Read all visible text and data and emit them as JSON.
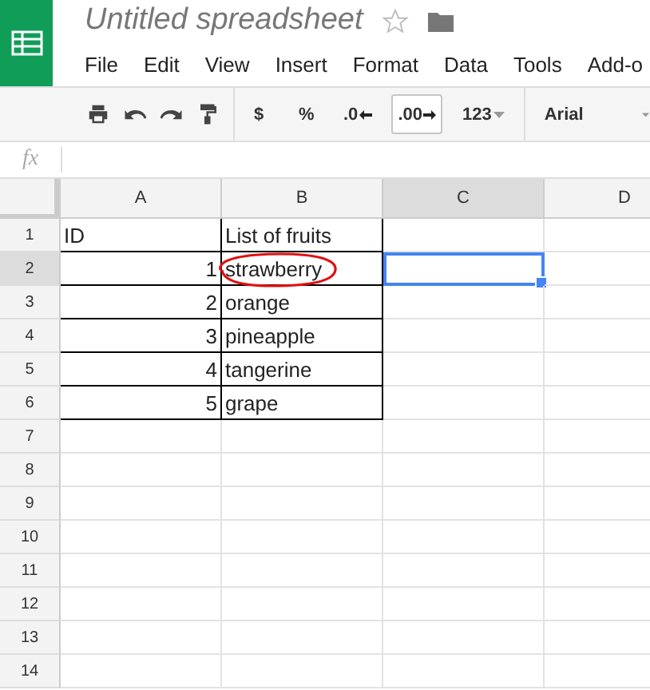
{
  "title": "Untitled spreadsheet",
  "menu": [
    "File",
    "Edit",
    "View",
    "Insert",
    "Format",
    "Data",
    "Tools",
    "Add-o"
  ],
  "toolbar": {
    "currency": "$",
    "percent": "%",
    "decrease_decimals": ".0",
    "increase_decimals": ".00",
    "increase_decimals_pressed": true,
    "number_format": "123",
    "font": "Arial"
  },
  "formula_bar": {
    "label": "fx"
  },
  "columns": [
    {
      "label": "A",
      "selected": false
    },
    {
      "label": "B",
      "selected": false
    },
    {
      "label": "C",
      "selected": true
    },
    {
      "label": "D",
      "selected": false
    }
  ],
  "rows": [
    {
      "number": "1",
      "selected": false,
      "cells": [
        {
          "kind": "text",
          "value": "ID"
        },
        {
          "kind": "text",
          "value": "List of fruits",
          "circled": false
        }
      ]
    },
    {
      "number": "2",
      "selected": true,
      "cells": [
        {
          "kind": "number",
          "value": "1"
        },
        {
          "kind": "text",
          "value": "strawberry",
          "circled": true
        }
      ]
    },
    {
      "number": "3",
      "selected": false,
      "cells": [
        {
          "kind": "number",
          "value": "2"
        },
        {
          "kind": "text",
          "value": "orange",
          "circled": false
        }
      ]
    },
    {
      "number": "4",
      "selected": false,
      "cells": [
        {
          "kind": "number",
          "value": "3"
        },
        {
          "kind": "text",
          "value": "pineapple",
          "circled": false
        }
      ]
    },
    {
      "number": "5",
      "selected": false,
      "cells": [
        {
          "kind": "number",
          "value": "4"
        },
        {
          "kind": "text",
          "value": "tangerine",
          "circled": false
        }
      ]
    },
    {
      "number": "6",
      "selected": false,
      "cells": [
        {
          "kind": "number",
          "value": "5"
        },
        {
          "kind": "text",
          "value": "grape",
          "circled": false
        }
      ]
    },
    {
      "number": "7",
      "selected": false
    },
    {
      "number": "8",
      "selected": false
    },
    {
      "number": "9",
      "selected": false
    },
    {
      "number": "10",
      "selected": false
    },
    {
      "number": "11",
      "selected": false
    },
    {
      "number": "12",
      "selected": false
    },
    {
      "number": "13",
      "selected": false
    },
    {
      "number": "14",
      "selected": false
    }
  ]
}
